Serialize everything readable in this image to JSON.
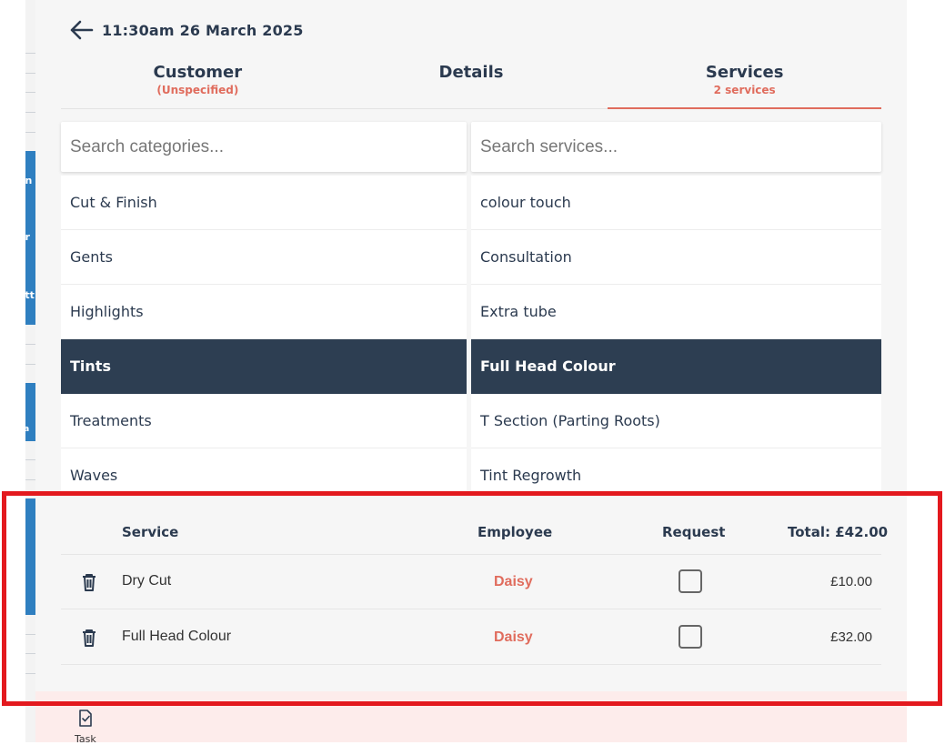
{
  "header": {
    "title": "11:30am 26 March 2025",
    "back_icon": "arrow-left-icon"
  },
  "tabs": [
    {
      "label": "Customer",
      "sub": "(Unspecified)"
    },
    {
      "label": "Details",
      "sub": ""
    },
    {
      "label": "Services",
      "sub": "2 services",
      "active": true
    }
  ],
  "search": {
    "categories_placeholder": "Search categories...",
    "services_placeholder": "Search services..."
  },
  "categories": [
    "Cut & Finish",
    "Gents",
    "Highlights",
    "Tints",
    "Treatments",
    "Waves"
  ],
  "selected_category": "Tints",
  "services": [
    "colour touch",
    "Consultation",
    "Extra tube",
    "Full Head Colour",
    "T Section (Parting Roots)",
    "Tint Regrowth"
  ],
  "selected_service": "Full Head Colour",
  "summary": {
    "col_service": "Service",
    "col_employee": "Employee",
    "col_request": "Request",
    "total": "Total: £42.00",
    "rows": [
      {
        "service": "Dry Cut",
        "employee": "Daisy",
        "request": false,
        "price": "£10.00"
      },
      {
        "service": "Full Head Colour",
        "employee": "Daisy",
        "request": false,
        "price": "£32.00"
      }
    ]
  },
  "footer": {
    "task_label": "Task",
    "task_icon": "clipboard-check-icon"
  },
  "colors": {
    "accent": "#e06c5d",
    "selected": "#2d3e52",
    "highlight": "#e3191e",
    "sidebar_blue": "#2f7fc0"
  },
  "sidebar_fragments": [
    "on",
    "er",
    "att",
    "ea"
  ]
}
